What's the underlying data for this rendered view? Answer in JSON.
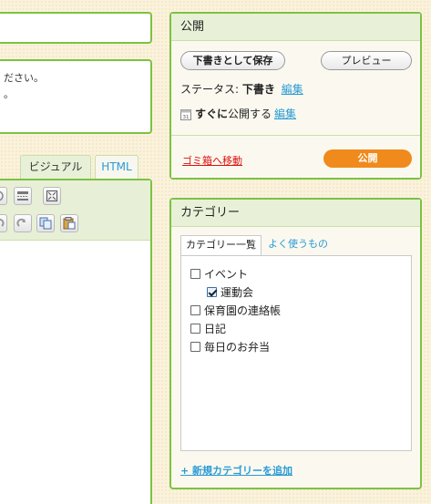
{
  "excerpt": {
    "line1": "ださい。",
    "line2": "。"
  },
  "editor": {
    "tab_visual": "ビジュアル",
    "tab_html": "HTML"
  },
  "publish": {
    "title": "公開",
    "save_draft": "下書きとして保存",
    "preview": "プレビュー",
    "status_label": "ステータス:",
    "status_value": "下書き",
    "status_edit": "編集",
    "schedule_prefix": "すぐに",
    "schedule_suffix": "公開する",
    "schedule_edit": "編集",
    "trash": "ゴミ箱へ移動",
    "publish_button": "公開"
  },
  "categories": {
    "title": "カテゴリー",
    "tab_all": "カテゴリー一覧",
    "tab_popular": "よく使うもの",
    "items": [
      {
        "label": "イベント",
        "checked": false,
        "child": false
      },
      {
        "label": "運動会",
        "checked": true,
        "child": true
      },
      {
        "label": "保育園の連絡帳",
        "checked": false,
        "child": false
      },
      {
        "label": "日記",
        "checked": false,
        "child": false
      },
      {
        "label": "毎日のお弁当",
        "checked": false,
        "child": false
      }
    ],
    "add_new": "+ 新規カテゴリーを追加"
  },
  "colors": {
    "accent_green": "#7cc242",
    "publish_orange": "#f08a1c",
    "link_blue": "#2a9bd6",
    "trash_red": "#dd1111"
  }
}
